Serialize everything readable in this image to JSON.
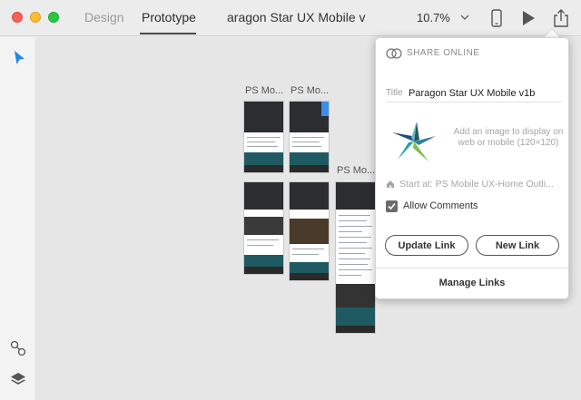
{
  "window": {
    "tabs": [
      {
        "label": "Design",
        "active": false
      },
      {
        "label": "Prototype",
        "active": true
      }
    ],
    "document_title": "aragon Star UX Mobile v",
    "zoom": "10.7%"
  },
  "toolbar": {
    "icons": [
      "chevron-down-icon",
      "phone-icon",
      "play-icon",
      "share-icon"
    ]
  },
  "sidebar": {
    "tools": [
      "select-arrow-icon",
      "link-icon",
      "layers-icon"
    ]
  },
  "canvas": {
    "artboards": [
      {
        "label": "PS Mo..."
      },
      {
        "label": "PS Mo..."
      },
      {
        "label": "PS Mo..."
      }
    ]
  },
  "share_panel": {
    "heading": "SHARE ONLINE",
    "title_label": "Title",
    "title_value": "Paragon Star UX Mobile v1b",
    "add_image_text": "Add an image to display on web or mobile (120×120)",
    "start_at": "Start at: PS Mobile UX-Home Outli...",
    "allow_comments_label": "Allow Comments",
    "allow_comments_checked": true,
    "update_link_label": "Update Link",
    "new_link_label": "New Link",
    "manage_links_label": "Manage Links"
  },
  "colors": {
    "accent_blue": "#3d8ee8",
    "teal": "#1f5a63",
    "dark": "#2b2d31"
  }
}
